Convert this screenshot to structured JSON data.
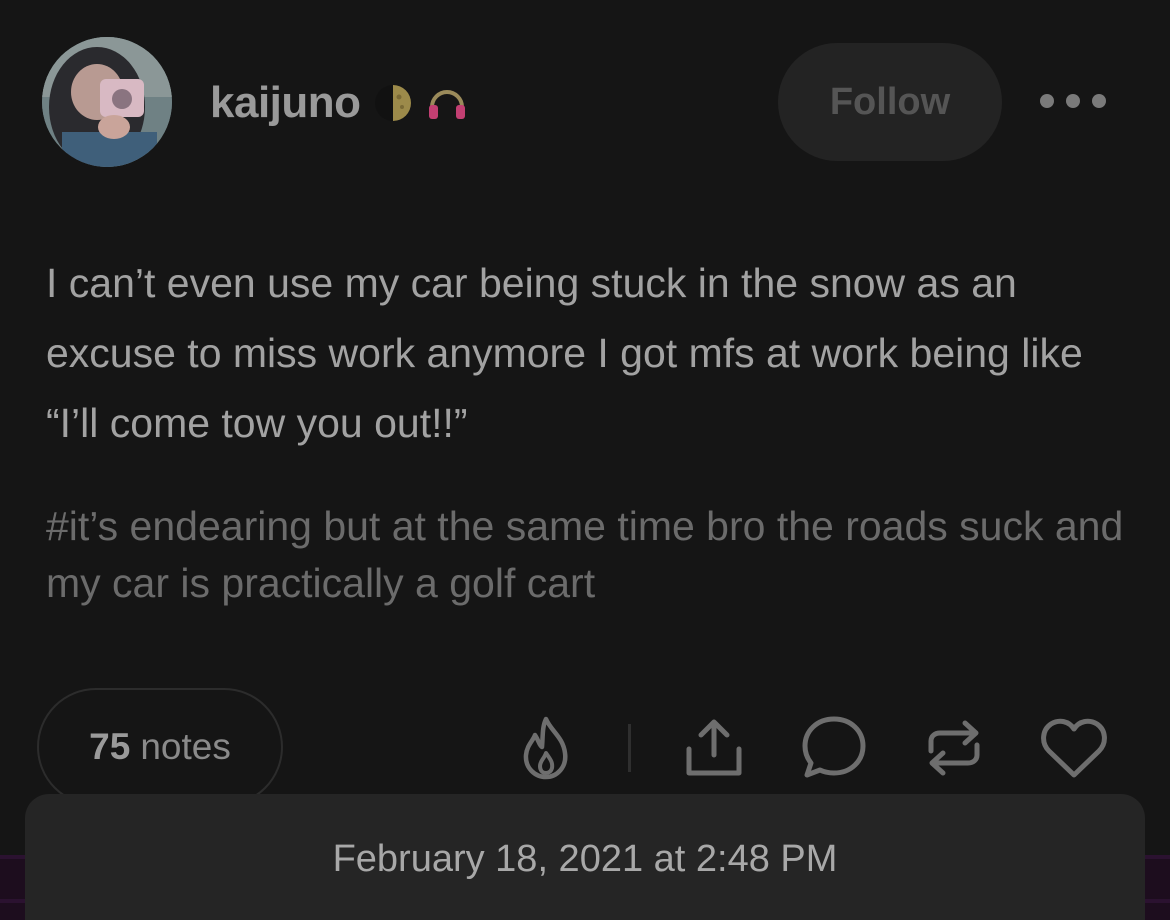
{
  "header": {
    "username": "kaijuno",
    "follow_label": "Follow",
    "badges": [
      "moon-badge-icon",
      "headphones-badge-icon"
    ]
  },
  "post": {
    "text": "I can’t even use my car being stuck in the snow as an excuse to miss work anymore I got mfs at work being like “I’ll come tow you out!!”",
    "tags": "#it’s endearing but at the same time bro the roads suck and my car is practically a golf cart"
  },
  "footer": {
    "notes_count": "75",
    "notes_label": "notes",
    "actions": [
      "flame-icon",
      "share-icon",
      "comment-icon",
      "reblog-icon",
      "heart-icon"
    ]
  },
  "sheet": {
    "timestamp": "February 18, 2021 at 2:48 PM"
  },
  "colors": {
    "background": "#151515",
    "text": "#a2a2a2",
    "tags": "#6b6b6b",
    "sheet": "#252525",
    "follow_bg": "#232323",
    "accent_headphones": "#d4467a"
  }
}
